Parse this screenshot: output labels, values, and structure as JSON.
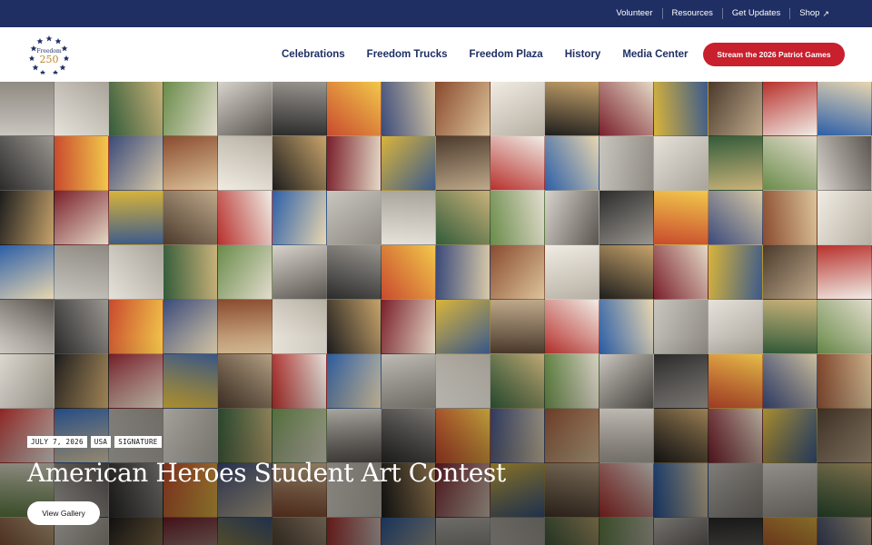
{
  "topbar": {
    "links": [
      {
        "label": "Volunteer"
      },
      {
        "label": "Resources"
      },
      {
        "label": "Get Updates"
      },
      {
        "label": "Shop"
      }
    ]
  },
  "logo": {
    "line1": "Freedom",
    "line2": "250"
  },
  "nav": {
    "links": [
      "Celebrations",
      "Freedom Trucks",
      "Freedom Plaza",
      "History",
      "Media Center"
    ],
    "cta": "Stream the 2026 Patriot Games"
  },
  "hero": {
    "tags": [
      "JULY 7, 2026",
      "USA",
      "SIGNATURE"
    ],
    "title": "American Heroes Student Art Contest",
    "button": "View Gallery"
  },
  "colors": {
    "brand_navy": "#1f2f63",
    "brand_red": "#c8202d"
  }
}
